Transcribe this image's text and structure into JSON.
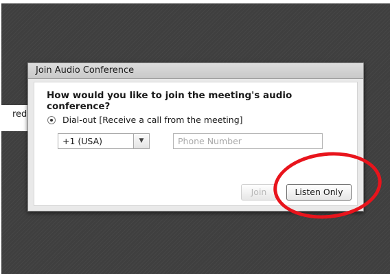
{
  "background": {
    "partial_text": "red."
  },
  "dialog": {
    "title": "Join Audio Conference",
    "question": "How would you like to join the meeting's audio conference?",
    "option": {
      "label": "Dial-out [Receive a call from the meeting]",
      "selected": true
    },
    "country_select": {
      "value": "+1 (USA)"
    },
    "phone_input": {
      "value": "",
      "placeholder": "Phone Number"
    },
    "join_label": "Join",
    "listen_only_label": "Listen Only"
  },
  "annotation": {
    "color": "#e8141c",
    "shape": "ellipse"
  }
}
